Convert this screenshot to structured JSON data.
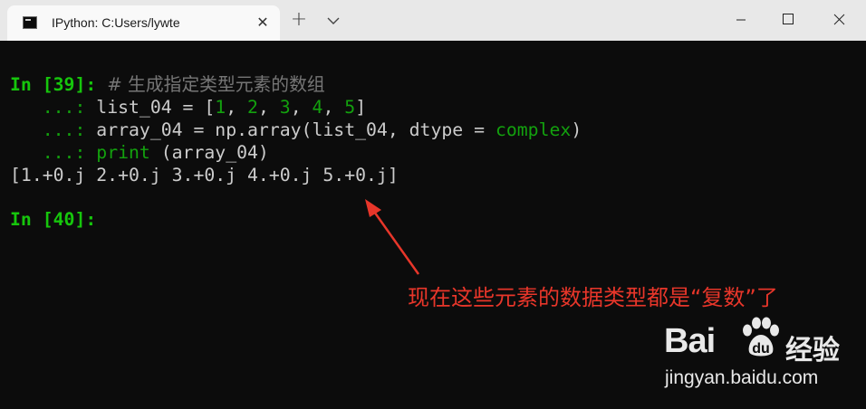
{
  "window": {
    "tab_title": "IPython: C:Users/lywte",
    "tab_close": "✕",
    "new_tab": "+"
  },
  "terminal": {
    "in39_prompt": "In [39]: ",
    "comment": "# 生成指定类型元素的数组",
    "cont_prompt": "   ...: ",
    "line2_pre": "list_04 = [",
    "n1": "1",
    "n2": "2",
    "n3": "3",
    "n4": "4",
    "n5": "5",
    "sep": ", ",
    "close_bracket": "]",
    "line3_pre": "array_04 = np.array(list_04, dtype = ",
    "line3_kw": "complex",
    "line3_post": ")",
    "line4_kw": "print",
    "line4_post": " (array_04)",
    "output": "[1.+0.j 2.+0.j 3.+0.j 4.+0.j 5.+0.j]",
    "in40_prompt": "In [40]:"
  },
  "annotation": {
    "text": "现在这些元素的数据类型都是“复数”了",
    "color": "#e8362a"
  },
  "watermark": {
    "logo": "Bai",
    "logo_tail": "经验",
    "url": "jingyan.baidu.com"
  },
  "colors": {
    "prompt_green": "#16c60c",
    "number_green": "#13a10e",
    "text": "#cccccc",
    "background": "#0c0c0c"
  }
}
